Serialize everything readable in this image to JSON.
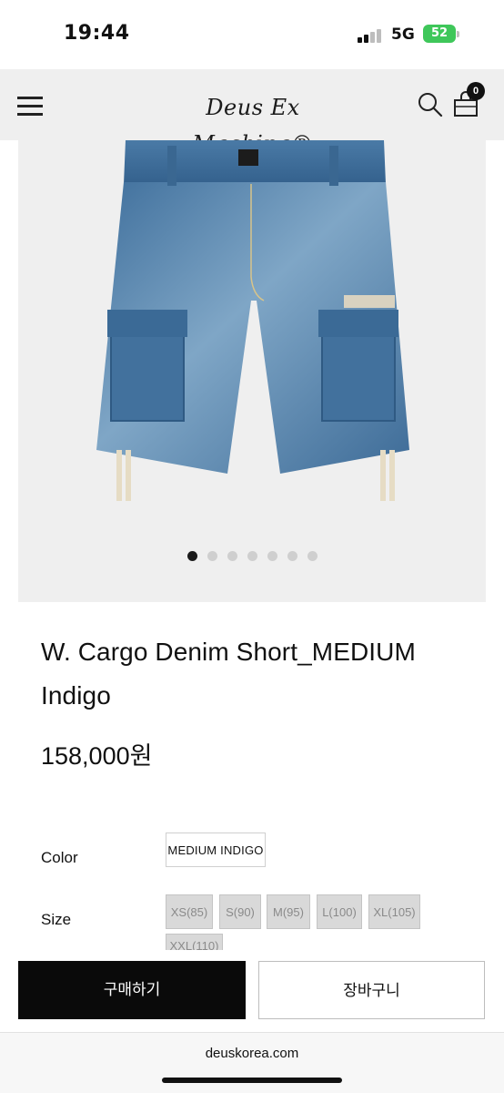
{
  "status_bar": {
    "time": "19:44",
    "network": "5G",
    "battery": "52"
  },
  "header": {
    "logo_text": "Deus Ex Machina®",
    "cart_count": "0",
    "icons": [
      "menu-icon",
      "search-icon",
      "cart-icon"
    ]
  },
  "gallery": {
    "slide_count": 7,
    "active_index": 0
  },
  "product": {
    "title": "W. Cargo Denim Short_MEDIUM Indigo",
    "price": "158,000원"
  },
  "options": {
    "color_label": "Color",
    "color_value": "MEDIUM INDIGO",
    "size_label": "Size",
    "sizes": [
      "XS(85)",
      "S(90)",
      "M(95)",
      "L(100)",
      "XL(105)",
      "XXL(110)"
    ]
  },
  "actions": {
    "buy_label": "구매하기",
    "cart_label": "장바구니"
  },
  "browser": {
    "url": "deuskorea.com"
  },
  "colors": {
    "header_bg": "#efefef",
    "buy_button_bg": "#0a0a0a",
    "size_disabled_bg": "#d9d9d9",
    "battery_green": "#3fc75a"
  }
}
